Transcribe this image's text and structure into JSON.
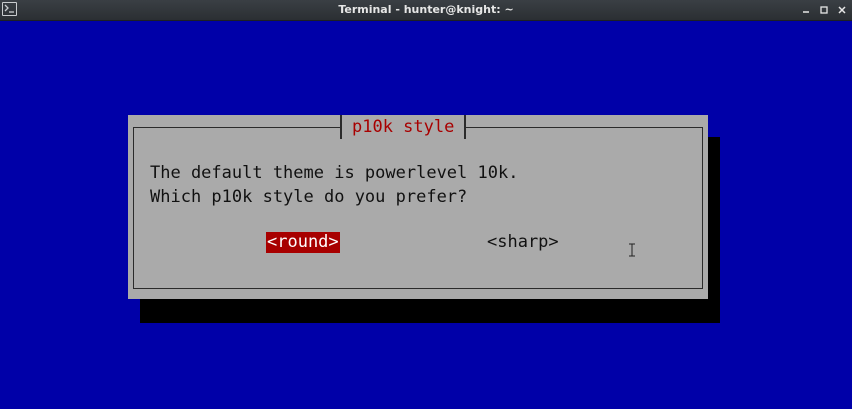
{
  "window": {
    "title": "Terminal - hunter@knight: ~",
    "controls": {
      "minimize_icon": "minimize-icon",
      "maximize_icon": "maximize-icon",
      "close_icon": "close-icon"
    }
  },
  "dialog": {
    "title": "p10k style",
    "line1": "The default theme is powerlevel 10k.",
    "line2": "Which p10k style do you prefer?",
    "options": [
      {
        "label": "<round>",
        "selected": true
      },
      {
        "label": "<sharp>",
        "selected": false
      }
    ]
  },
  "colors": {
    "background": "#0000a8",
    "dialog": "#aaaaaa",
    "selected": "#a80000",
    "title_text": "#a80000"
  }
}
